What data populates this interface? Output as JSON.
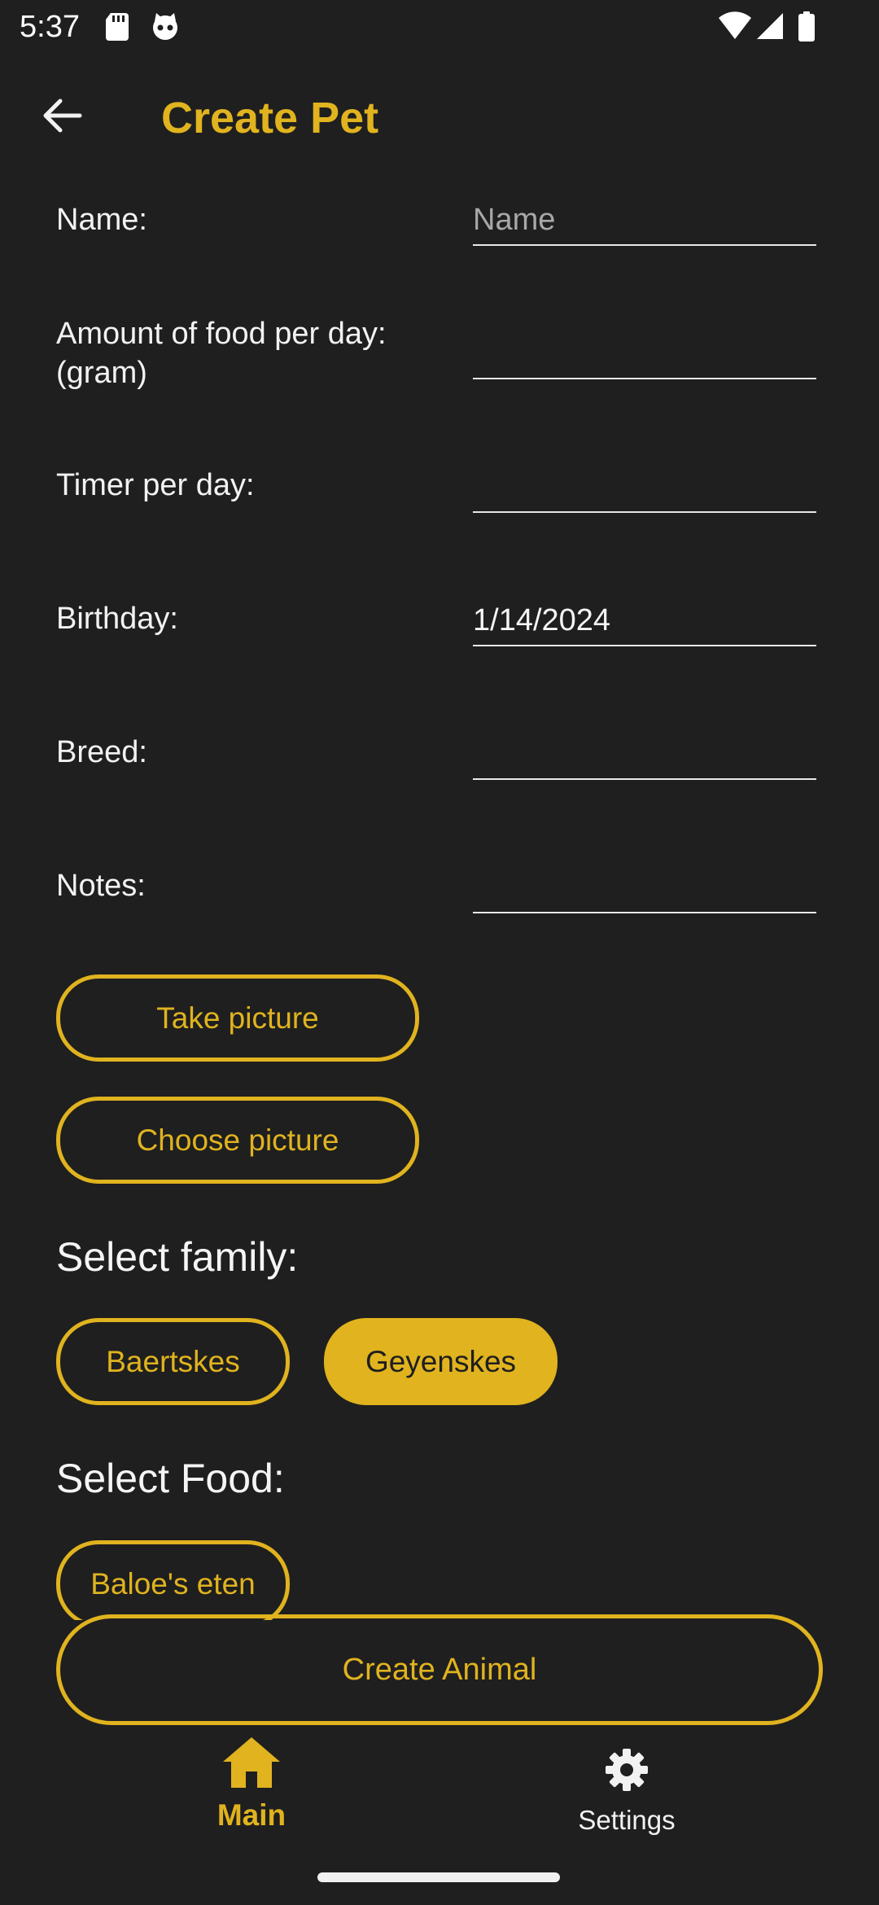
{
  "status_bar": {
    "time": "5:37"
  },
  "app_bar": {
    "title": "Create Pet",
    "back_icon": "arrow-left-icon"
  },
  "form": {
    "name": {
      "label": "Name:",
      "placeholder": "Name",
      "value": ""
    },
    "food_amount": {
      "label_line1": "Amount of food per day:",
      "label_line2": "(gram)",
      "value": ""
    },
    "timer": {
      "label": "Timer per day:",
      "value": ""
    },
    "birthday": {
      "label": "Birthday:",
      "value": "1/14/2024"
    },
    "breed": {
      "label": "Breed:",
      "value": ""
    },
    "notes": {
      "label": "Notes:",
      "value": ""
    }
  },
  "picture_buttons": {
    "take": "Take picture",
    "choose": "Choose picture"
  },
  "family": {
    "heading": "Select family:",
    "options": [
      {
        "label": "Baertskes",
        "selected": false
      },
      {
        "label": "Geyenskes",
        "selected": true
      }
    ]
  },
  "food": {
    "heading": "Select Food:",
    "options": [
      {
        "label": "Baloe's eten",
        "selected": false
      }
    ]
  },
  "create_button": "Create Animal",
  "bottom_nav": {
    "items": [
      {
        "label": "Main",
        "icon": "home-icon",
        "active": true
      },
      {
        "label": "Settings",
        "icon": "gear-icon",
        "active": false
      }
    ]
  },
  "colors": {
    "accent": "#e0b31f",
    "background": "#1f1f1f",
    "text": "#f2f2f2"
  }
}
